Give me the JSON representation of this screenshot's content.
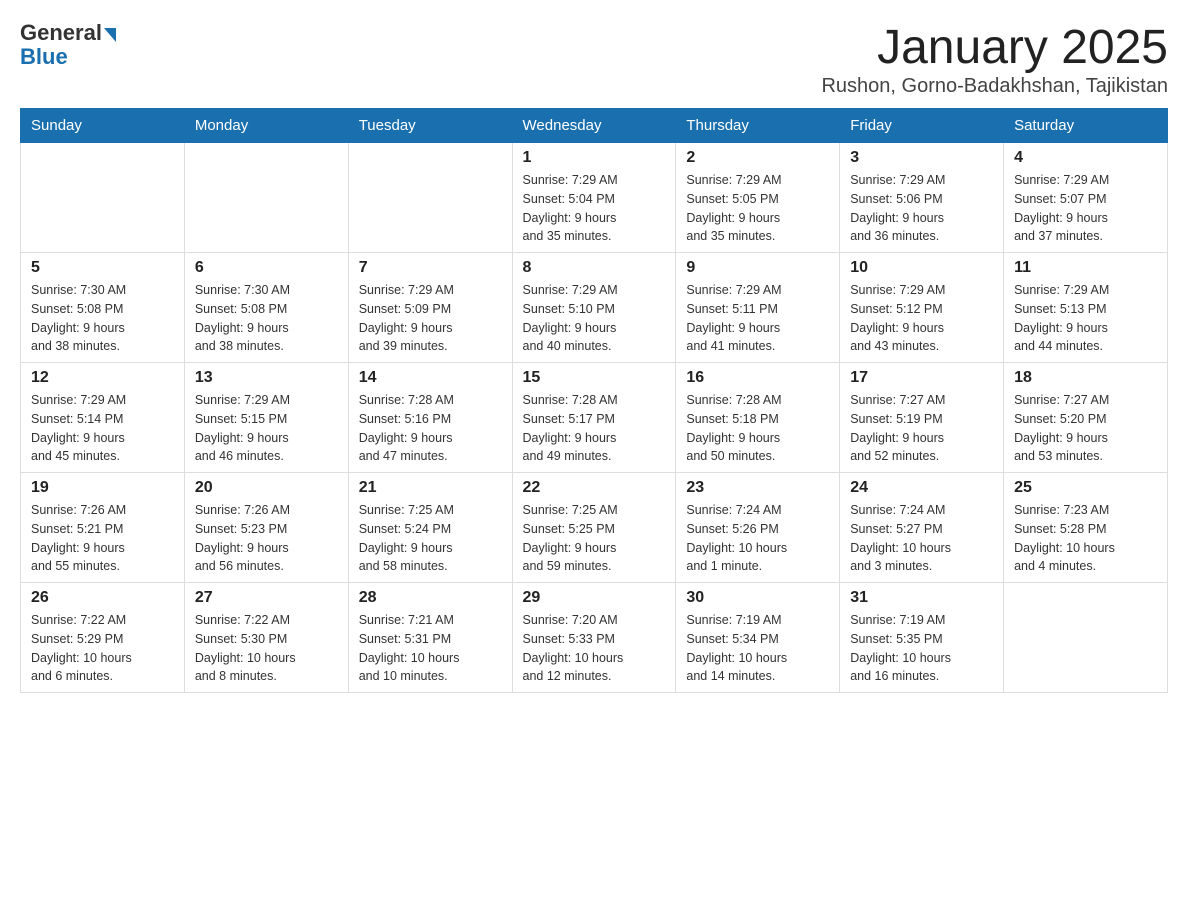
{
  "header": {
    "logo": {
      "general": "General",
      "blue": "Blue"
    },
    "title": "January 2025",
    "subtitle": "Rushon, Gorno-Badakhshan, Tajikistan"
  },
  "weekdays": [
    "Sunday",
    "Monday",
    "Tuesday",
    "Wednesday",
    "Thursday",
    "Friday",
    "Saturday"
  ],
  "weeks": [
    [
      {
        "day": "",
        "info": ""
      },
      {
        "day": "",
        "info": ""
      },
      {
        "day": "",
        "info": ""
      },
      {
        "day": "1",
        "info": "Sunrise: 7:29 AM\nSunset: 5:04 PM\nDaylight: 9 hours\nand 35 minutes."
      },
      {
        "day": "2",
        "info": "Sunrise: 7:29 AM\nSunset: 5:05 PM\nDaylight: 9 hours\nand 35 minutes."
      },
      {
        "day": "3",
        "info": "Sunrise: 7:29 AM\nSunset: 5:06 PM\nDaylight: 9 hours\nand 36 minutes."
      },
      {
        "day": "4",
        "info": "Sunrise: 7:29 AM\nSunset: 5:07 PM\nDaylight: 9 hours\nand 37 minutes."
      }
    ],
    [
      {
        "day": "5",
        "info": "Sunrise: 7:30 AM\nSunset: 5:08 PM\nDaylight: 9 hours\nand 38 minutes."
      },
      {
        "day": "6",
        "info": "Sunrise: 7:30 AM\nSunset: 5:08 PM\nDaylight: 9 hours\nand 38 minutes."
      },
      {
        "day": "7",
        "info": "Sunrise: 7:29 AM\nSunset: 5:09 PM\nDaylight: 9 hours\nand 39 minutes."
      },
      {
        "day": "8",
        "info": "Sunrise: 7:29 AM\nSunset: 5:10 PM\nDaylight: 9 hours\nand 40 minutes."
      },
      {
        "day": "9",
        "info": "Sunrise: 7:29 AM\nSunset: 5:11 PM\nDaylight: 9 hours\nand 41 minutes."
      },
      {
        "day": "10",
        "info": "Sunrise: 7:29 AM\nSunset: 5:12 PM\nDaylight: 9 hours\nand 43 minutes."
      },
      {
        "day": "11",
        "info": "Sunrise: 7:29 AM\nSunset: 5:13 PM\nDaylight: 9 hours\nand 44 minutes."
      }
    ],
    [
      {
        "day": "12",
        "info": "Sunrise: 7:29 AM\nSunset: 5:14 PM\nDaylight: 9 hours\nand 45 minutes."
      },
      {
        "day": "13",
        "info": "Sunrise: 7:29 AM\nSunset: 5:15 PM\nDaylight: 9 hours\nand 46 minutes."
      },
      {
        "day": "14",
        "info": "Sunrise: 7:28 AM\nSunset: 5:16 PM\nDaylight: 9 hours\nand 47 minutes."
      },
      {
        "day": "15",
        "info": "Sunrise: 7:28 AM\nSunset: 5:17 PM\nDaylight: 9 hours\nand 49 minutes."
      },
      {
        "day": "16",
        "info": "Sunrise: 7:28 AM\nSunset: 5:18 PM\nDaylight: 9 hours\nand 50 minutes."
      },
      {
        "day": "17",
        "info": "Sunrise: 7:27 AM\nSunset: 5:19 PM\nDaylight: 9 hours\nand 52 minutes."
      },
      {
        "day": "18",
        "info": "Sunrise: 7:27 AM\nSunset: 5:20 PM\nDaylight: 9 hours\nand 53 minutes."
      }
    ],
    [
      {
        "day": "19",
        "info": "Sunrise: 7:26 AM\nSunset: 5:21 PM\nDaylight: 9 hours\nand 55 minutes."
      },
      {
        "day": "20",
        "info": "Sunrise: 7:26 AM\nSunset: 5:23 PM\nDaylight: 9 hours\nand 56 minutes."
      },
      {
        "day": "21",
        "info": "Sunrise: 7:25 AM\nSunset: 5:24 PM\nDaylight: 9 hours\nand 58 minutes."
      },
      {
        "day": "22",
        "info": "Sunrise: 7:25 AM\nSunset: 5:25 PM\nDaylight: 9 hours\nand 59 minutes."
      },
      {
        "day": "23",
        "info": "Sunrise: 7:24 AM\nSunset: 5:26 PM\nDaylight: 10 hours\nand 1 minute."
      },
      {
        "day": "24",
        "info": "Sunrise: 7:24 AM\nSunset: 5:27 PM\nDaylight: 10 hours\nand 3 minutes."
      },
      {
        "day": "25",
        "info": "Sunrise: 7:23 AM\nSunset: 5:28 PM\nDaylight: 10 hours\nand 4 minutes."
      }
    ],
    [
      {
        "day": "26",
        "info": "Sunrise: 7:22 AM\nSunset: 5:29 PM\nDaylight: 10 hours\nand 6 minutes."
      },
      {
        "day": "27",
        "info": "Sunrise: 7:22 AM\nSunset: 5:30 PM\nDaylight: 10 hours\nand 8 minutes."
      },
      {
        "day": "28",
        "info": "Sunrise: 7:21 AM\nSunset: 5:31 PM\nDaylight: 10 hours\nand 10 minutes."
      },
      {
        "day": "29",
        "info": "Sunrise: 7:20 AM\nSunset: 5:33 PM\nDaylight: 10 hours\nand 12 minutes."
      },
      {
        "day": "30",
        "info": "Sunrise: 7:19 AM\nSunset: 5:34 PM\nDaylight: 10 hours\nand 14 minutes."
      },
      {
        "day": "31",
        "info": "Sunrise: 7:19 AM\nSunset: 5:35 PM\nDaylight: 10 hours\nand 16 minutes."
      },
      {
        "day": "",
        "info": ""
      }
    ]
  ]
}
